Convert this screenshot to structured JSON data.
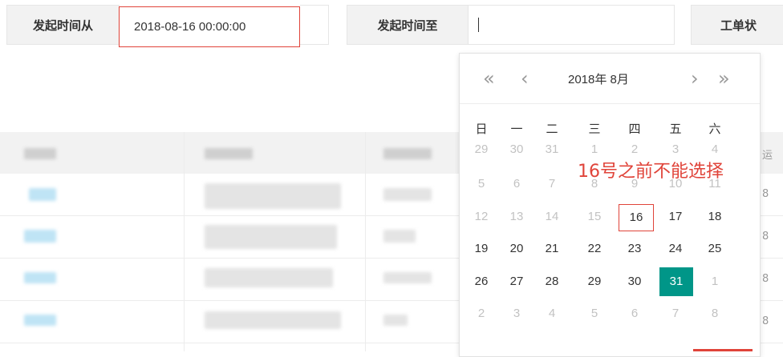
{
  "filters": {
    "start_label": "发起时间从",
    "start_value": "2018-08-16 00:00:00",
    "end_label": "发起时间至",
    "end_value": "",
    "status_label": "工单状"
  },
  "datepicker": {
    "year_month": "2018年  8月",
    "weekdays": [
      "日",
      "一",
      "二",
      "三",
      "四",
      "五",
      "六"
    ],
    "weeks": [
      [
        {
          "d": "29",
          "s": "other"
        },
        {
          "d": "30",
          "s": "other"
        },
        {
          "d": "31",
          "s": "other"
        },
        {
          "d": "1",
          "s": "disabled"
        },
        {
          "d": "2",
          "s": "disabled"
        },
        {
          "d": "3",
          "s": "disabled"
        },
        {
          "d": "4",
          "s": "disabled"
        }
      ],
      [
        {
          "d": "5",
          "s": "disabled"
        },
        {
          "d": "6",
          "s": "disabled"
        },
        {
          "d": "7",
          "s": "disabled"
        },
        {
          "d": "8",
          "s": "disabled"
        },
        {
          "d": "9",
          "s": "disabled"
        },
        {
          "d": "10",
          "s": "disabled"
        },
        {
          "d": "11",
          "s": "disabled"
        }
      ],
      [
        {
          "d": "12",
          "s": "disabled"
        },
        {
          "d": "13",
          "s": "disabled"
        },
        {
          "d": "14",
          "s": "disabled"
        },
        {
          "d": "15",
          "s": "disabled"
        },
        {
          "d": "16",
          "s": "boxed"
        },
        {
          "d": "17",
          "s": "normal"
        },
        {
          "d": "18",
          "s": "normal"
        }
      ],
      [
        {
          "d": "19",
          "s": "normal"
        },
        {
          "d": "20",
          "s": "normal"
        },
        {
          "d": "21",
          "s": "normal"
        },
        {
          "d": "22",
          "s": "normal"
        },
        {
          "d": "23",
          "s": "normal"
        },
        {
          "d": "24",
          "s": "normal"
        },
        {
          "d": "25",
          "s": "normal"
        }
      ],
      [
        {
          "d": "26",
          "s": "normal"
        },
        {
          "d": "27",
          "s": "normal"
        },
        {
          "d": "28",
          "s": "normal"
        },
        {
          "d": "29",
          "s": "normal"
        },
        {
          "d": "30",
          "s": "normal"
        },
        {
          "d": "31",
          "s": "selected"
        },
        {
          "d": "1",
          "s": "other"
        }
      ],
      [
        {
          "d": "2",
          "s": "other"
        },
        {
          "d": "3",
          "s": "other"
        },
        {
          "d": "4",
          "s": "other"
        },
        {
          "d": "5",
          "s": "other"
        },
        {
          "d": "6",
          "s": "other"
        },
        {
          "d": "7",
          "s": "other"
        },
        {
          "d": "8",
          "s": "other"
        }
      ]
    ],
    "annotation": "16号之前不能选择"
  },
  "table_edge_text": [
    "运",
    "8",
    "8",
    "8",
    "8"
  ],
  "colors": {
    "accent": "#009688",
    "annotation_red": "#e0443a"
  }
}
